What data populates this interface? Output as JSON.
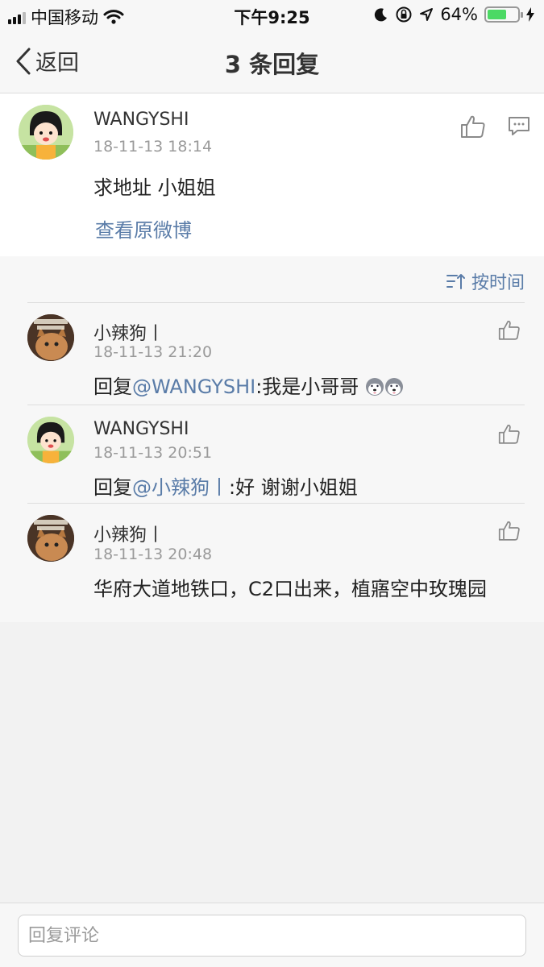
{
  "status_bar": {
    "carrier": "中国移动",
    "time": "下午9:25",
    "battery": "64%",
    "battery_level": 0.64
  },
  "nav": {
    "back_label": "返回",
    "title": "3 条回复"
  },
  "main_comment": {
    "username": "WANGYSHI",
    "timestamp": "18-11-13 18:14",
    "text": "求地址 小姐姐",
    "view_original": "查看原微博"
  },
  "sort": {
    "label": "按时间"
  },
  "replies": [
    {
      "username": "小辣狗丨",
      "timestamp": "18-11-13 21:20",
      "prefix": "回复",
      "mention": "@WANGYSHI",
      "text": ":我是小哥哥",
      "emoji": [
        "husky-face",
        "husky-face"
      ]
    },
    {
      "username": "WANGYSHI",
      "timestamp": "18-11-13 20:51",
      "prefix": "回复",
      "mention": "@小辣狗丨",
      "text": ":好 谢谢小姐姐"
    },
    {
      "username": "小辣狗丨",
      "timestamp": "18-11-13 20:48",
      "text": "华府大道地铁口，C2口出来，植寤空中玫瑰园"
    }
  ],
  "composer": {
    "placeholder": "回复评论"
  },
  "colors": {
    "link": "#5a7ca8",
    "battery_green": "#4cd964",
    "background": "#f2f2f2"
  }
}
